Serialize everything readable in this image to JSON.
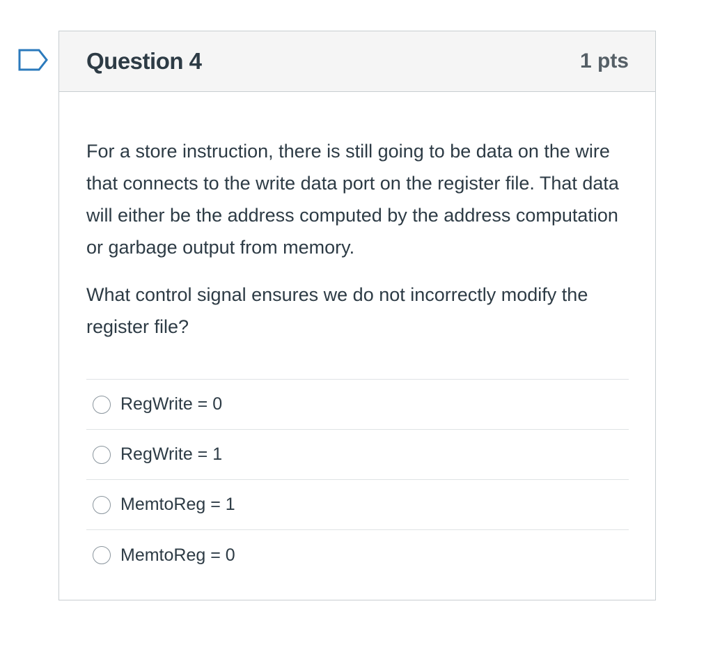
{
  "question": {
    "title": "Question 4",
    "points": "1 pts",
    "text_paragraph_1": "For a store instruction, there is still going to be data on the wire that connects to the write data port on the register file.  That data will either be the address computed by the address computation or garbage output from memory.",
    "text_paragraph_2": "What control signal ensures we do not incorrectly modify the register file?",
    "answers": [
      {
        "label": "RegWrite = 0",
        "selected": false
      },
      {
        "label": "RegWrite = 1",
        "selected": false
      },
      {
        "label": "MemtoReg = 1",
        "selected": false
      },
      {
        "label": "MemtoReg = 0",
        "selected": false
      }
    ]
  },
  "icons": {
    "flag": "flag-question-icon"
  },
  "colors": {
    "flag_stroke": "#2b7abc",
    "header_bg": "#f5f5f5",
    "border": "#c7cdd1",
    "text": "#2d3b45"
  }
}
